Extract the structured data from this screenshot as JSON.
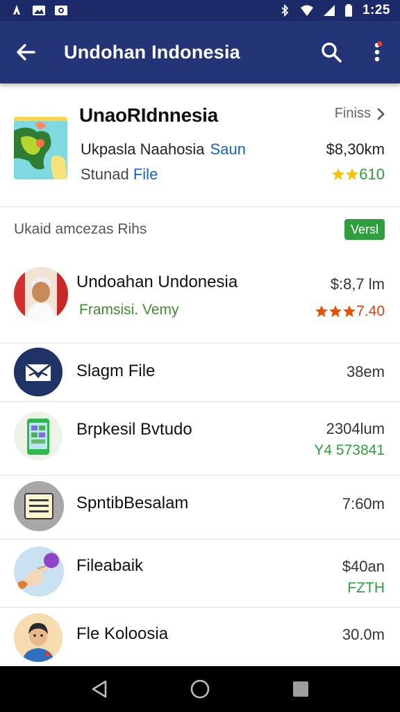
{
  "status_bar": {
    "time": "1:25",
    "left_icons": [
      "notification-icon",
      "image-icon",
      "photo-icon"
    ],
    "right_icons": [
      "bluetooth-icon",
      "wifi-icon",
      "signal-icon",
      "battery-icon"
    ]
  },
  "app_bar": {
    "title": "Undohan Indonesia",
    "back_icon": "arrow-back-icon",
    "search_icon": "search-icon",
    "menu_icon": "more-vert-icon",
    "accent_color": "#233577"
  },
  "featured": {
    "title": "UnaoRIdnnesia",
    "link": "Finiss",
    "subtitle": "Ukpasla Naahosia",
    "subtitle_accent": "Saun",
    "price": "$8,30km",
    "file_label_prefix": "Stunad",
    "file_label_accent": "File",
    "rating_value": "610",
    "stars": 2
  },
  "section": {
    "label": "Ukaid amcezas Rihs",
    "badge": "Versl"
  },
  "items": [
    {
      "name": "Undoahan Undonesia",
      "sub": "Framsisi. Vemy",
      "value": "$:8,7 lm",
      "value2": "7.40",
      "stars": 3,
      "avatar": "person-photo-icon"
    },
    {
      "name": "Slagm File",
      "value": "38em",
      "avatar": "inbox-tray-icon"
    },
    {
      "name": "Brpkesil Bvtudo",
      "value": "2304lum",
      "value2": "Y4 573841",
      "avatar": "phone-app-icon"
    },
    {
      "name": "SpntibBesalam",
      "value": "7:60m",
      "avatar": "notes-icon"
    },
    {
      "name": "Fileabaik",
      "value": "$40an",
      "value2": "FZTH",
      "avatar": "hand-ball-icon"
    },
    {
      "name": "Fle Koloosia",
      "value": "30.0m",
      "avatar": "person-avatar-icon"
    }
  ],
  "nav_bar": {
    "buttons": [
      "back-triangle-icon",
      "home-circle-icon",
      "recents-square-icon"
    ]
  }
}
